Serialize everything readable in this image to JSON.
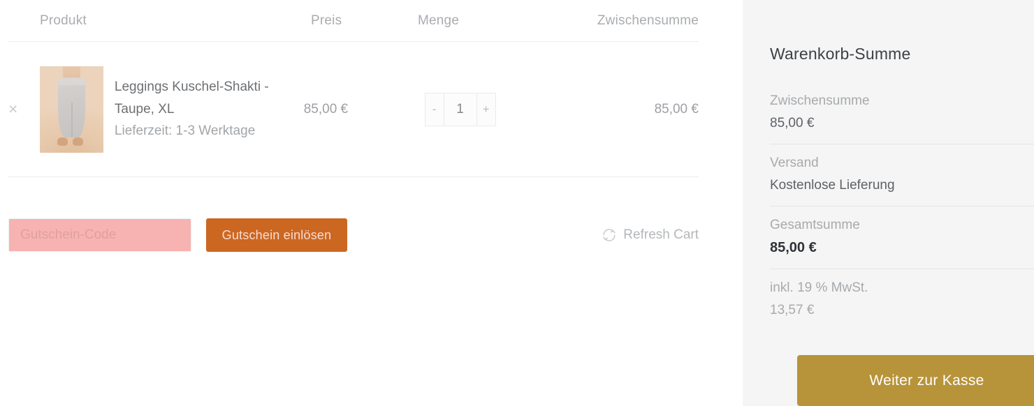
{
  "cart": {
    "columns": {
      "product": "Produkt",
      "price": "Preis",
      "quantity": "Menge",
      "subtotal": "Zwischensumme"
    },
    "items": [
      {
        "remove_label": "×",
        "name": "Leggings Kuschel-Shakti - Taupe, XL",
        "delivery": "Lieferzeit: 1-3 Werktage",
        "price": "85,00 €",
        "quantity": "1",
        "decrement_label": "-",
        "increment_label": "+",
        "subtotal": "85,00 €",
        "thumbnail_alt": "product-thumbnail"
      }
    ],
    "coupon": {
      "placeholder": "Gutschein-Code",
      "value": "",
      "apply_label": "Gutschein einlösen"
    },
    "refresh_label": "Refresh Cart"
  },
  "summary": {
    "title": "Warenkorb-Summe",
    "rows": [
      {
        "label": "Zwischensumme",
        "value": "85,00 €",
        "emphasis": "normal"
      },
      {
        "label": "Versand",
        "value": "Kostenlose Lieferung",
        "emphasis": "normal"
      },
      {
        "label": "Gesamtsumme",
        "value": "85,00 €",
        "emphasis": "strong"
      },
      {
        "label": "inkl. 19 % MwSt.",
        "value": "13,57 €",
        "emphasis": "muted"
      }
    ],
    "checkout_label": "Weiter zur Kasse"
  },
  "colors": {
    "coupon_input_bg": "#f6b3b1",
    "coupon_button_bg": "#cc6722",
    "checkout_button_bg": "#b7933a",
    "summary_panel_bg": "#f5f5f5",
    "muted_text": "#a7aaad"
  }
}
